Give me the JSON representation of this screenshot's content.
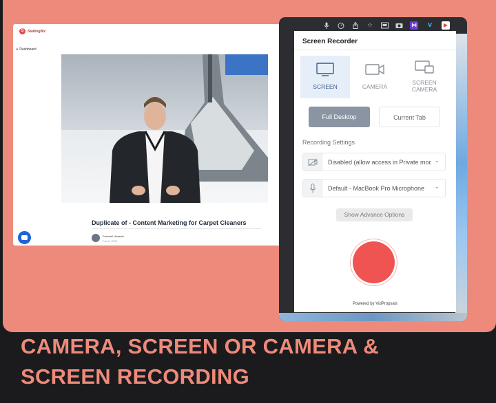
{
  "app": {
    "brand": "StarlingBiz",
    "nav_dashboard": "Dashboard",
    "video_title": "Duplicate of -  Content Marketing for Carpet Cleaners",
    "author_name": "Farewell Hussain",
    "author_date": "Feb 2, 2023"
  },
  "browser": {
    "toolbar_icons": [
      "mic-icon",
      "speed-icon",
      "share-icon",
      "star-icon",
      "cast-icon",
      "camera-icon",
      "vidextension-icon",
      "vimeo-icon",
      "play-icon"
    ]
  },
  "recorder": {
    "title": "Screen Recorder",
    "tabs": [
      {
        "label": "SCREEN",
        "active": true
      },
      {
        "label": "CAMERA",
        "active": false
      },
      {
        "label": "SCREEN CAMERA",
        "active": false
      }
    ],
    "mode_full": "Full Desktop",
    "mode_tab": "Current Tab",
    "settings_label": "Recording Settings",
    "camera_select": "Disabled (allow access in Private mode)",
    "mic_select": "Default - MacBook Pro Microphone",
    "advance_button": "Show Advance Options",
    "powered_by": "Powered by VidPropsals",
    "colors": {
      "active_tab": "#e6eef9",
      "record": "#ef5453",
      "full_desktop": "#8a94a2"
    }
  },
  "headline": {
    "line1": "CAMERA, SCREEN OR CAMERA &",
    "line2": "SCREEN RECORDING",
    "color": "#ee8a7b"
  }
}
